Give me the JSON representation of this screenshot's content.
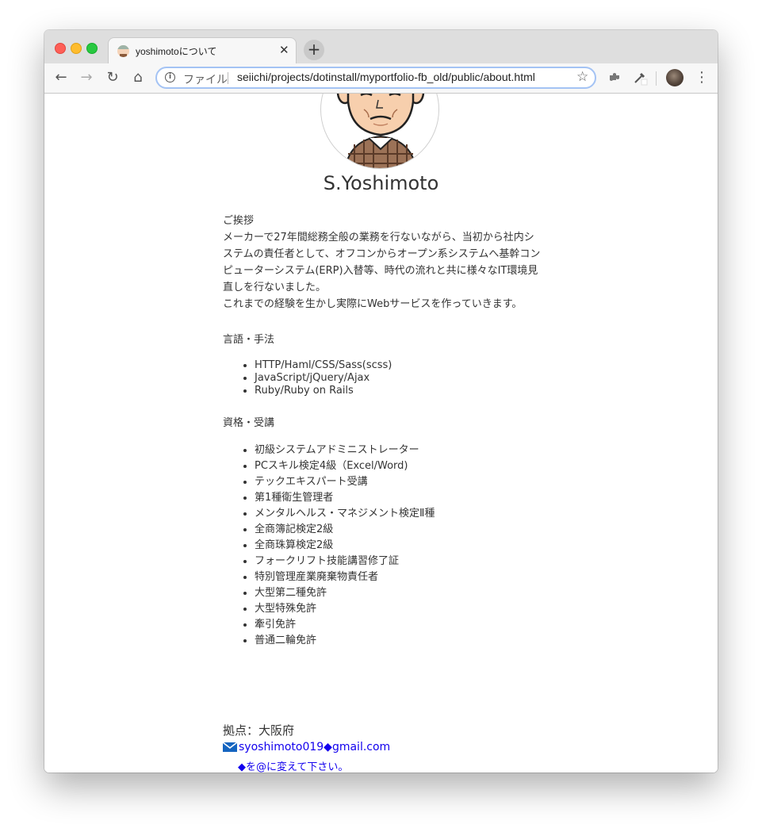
{
  "browser": {
    "tab_title": "yoshimotoについて",
    "tab_close": "✕",
    "new_tab": "+",
    "scheme_label": "ファイル",
    "url": "seiichi/projects/dotinstall/myportfolio-fb_old/public/about.html",
    "back_icon": "←",
    "forward_icon": "→",
    "reload_icon": "↻",
    "home_icon": "⌂",
    "star_icon": "☆",
    "menu_icon": "⋮"
  },
  "profile": {
    "name": "S.Yoshimoto"
  },
  "greeting": {
    "heading": "ご挨拶",
    "body": "メーカーで27年間総務全般の業務を行ないながら、当初から社内システムの責任者として、オフコンからオープン系システムへ基幹コンピューターシステム(ERP)入替等、時代の流れと共に様々なIT環境見直しを行ないました。",
    "body2": "これまでの経験を生かし実際にWebサービスを作っていきます。"
  },
  "skills": {
    "heading": "言語・手法",
    "items": [
      "HTTP/Haml/CSS/Sass(scss)",
      "JavaScript/jQuery/Ajax",
      "Ruby/Ruby on Rails"
    ]
  },
  "qualifications": {
    "heading": "資格・受講",
    "items": [
      "初級システムアドミニストレーター",
      "PCスキル検定4級（Excel/Word)",
      "テックエキスパート受講",
      "第1種衛生管理者",
      "メンタルヘルス・マネジメント検定Ⅱ種",
      "全商簿記検定2級",
      "全商珠算検定2級",
      "フォークリフト技能講習修了証",
      "特別管理産業廃棄物責任者",
      "大型第二種免許",
      "大型特殊免許",
      "牽引免許",
      "普通二輪免許"
    ]
  },
  "contact": {
    "base": "拠点：大阪府",
    "email": "syoshimoto019◆gmail.com",
    "note": "◆を@に変えて下さい。"
  }
}
